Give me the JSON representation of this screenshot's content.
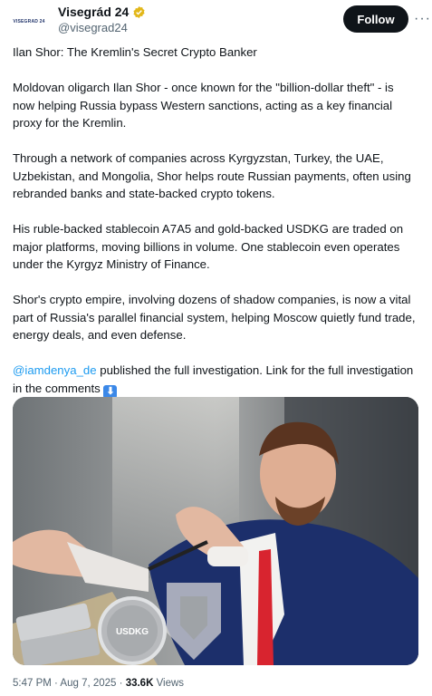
{
  "account": {
    "display_name": "Visegrád 24",
    "handle": "@visegrad24",
    "avatar_text": "VISEGRAD 24"
  },
  "actions": {
    "follow_label": "Follow",
    "more_label": "···"
  },
  "tweet": {
    "paragraphs": [
      "Ilan Shor: The Kremlin's Secret Crypto Banker",
      "Moldovan oligarch Ilan Shor - once known for the \"billion-dollar theft\" - is now helping Russia bypass Western sanctions, acting as a key financial proxy for the Kremlin.",
      "Through a network of companies across Kyrgyzstan, Turkey, the UAE, Uzbekistan, and Mongolia, Shor helps route Russian payments, often using rebranded banks and state-backed crypto tokens.",
      "His ruble-backed stablecoin A7A5 and gold-backed USDKG are traded on major platforms, moving billions in volume. One stablecoin even operates under the Kyrgyz Ministry of Finance.",
      "Shor's crypto empire, involving dozens of shadow companies, is now a vital part of Russia's parallel financial system, helping Moscow quietly fund trade, energy deals, and even defense."
    ],
    "mention": "@iamdenya_de",
    "last_paragraph": " published the full investigation. Link for the full investigation in the comments ",
    "emoji": "⬇"
  },
  "media": {
    "coin_label": "USDKG"
  },
  "meta": {
    "time": "5:47 PM",
    "separator": " · ",
    "date": "Aug 7, 2025",
    "views_count": "33.6K",
    "views_label": " Views"
  },
  "colors": {
    "link": "#1d9bf0",
    "follow_bg": "#0f1419",
    "secondary_text": "#536471",
    "verified_gold": "#e2b719"
  }
}
